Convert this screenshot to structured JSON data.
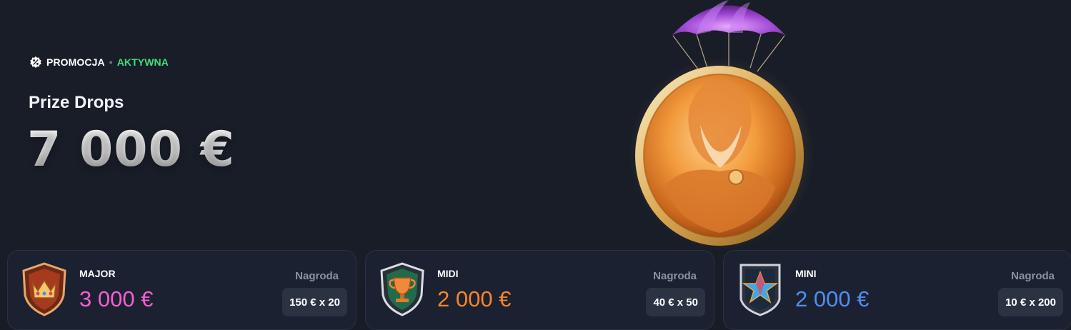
{
  "promo": {
    "tag": "PROMOCJA",
    "separator": "•",
    "status": "AKTYWNA",
    "title": "Prize Drops",
    "amount": "7 000 €"
  },
  "tiers": [
    {
      "name": "MAJOR",
      "amount": "3 000 €",
      "reward_label": "Nagroda",
      "reward": "150 € x 20",
      "amount_color": "#f45fd0",
      "emblem": "crown-shield-icon"
    },
    {
      "name": "MIDI",
      "amount": "2 000 €",
      "reward_label": "Nagroda",
      "reward": "40 € x 50",
      "amount_color": "#f5862a",
      "emblem": "trophy-shield-icon"
    },
    {
      "name": "MINI",
      "amount": "2 000 €",
      "reward_label": "Nagroda",
      "reward": "10 € x 200",
      "amount_color": "#4f8ef2",
      "emblem": "star-shield-icon"
    }
  ],
  "colors": {
    "background": "#171c26",
    "status_active": "#3ee07a",
    "card": "#1b2130"
  }
}
